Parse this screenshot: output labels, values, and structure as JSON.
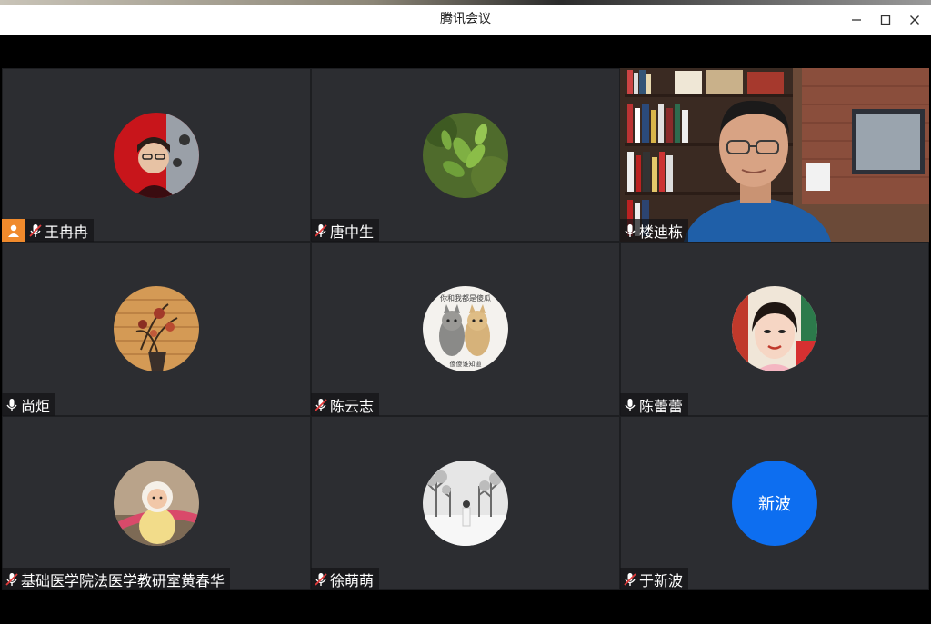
{
  "window": {
    "title": "腾讯会议"
  },
  "participants": [
    {
      "name": "王冉冉",
      "mic": "muted",
      "host": true,
      "avatar": "red-portrait-avatar"
    },
    {
      "name": "唐中生",
      "mic": "muted",
      "host": false,
      "avatar": "green-leaves-avatar"
    },
    {
      "name": "楼迪栋",
      "mic": "on",
      "host": false,
      "avatar": "camera-video",
      "active": true
    },
    {
      "name": "尚炬",
      "mic": "on",
      "host": false,
      "avatar": "flower-vase-avatar"
    },
    {
      "name": "陈云志",
      "mic": "muted",
      "host": false,
      "avatar": "two-cats-avatar",
      "avatar_text": [
        "你和我都是傻瓜",
        "傻傻谁知道"
      ]
    },
    {
      "name": "陈蕾蕾",
      "mic": "on",
      "host": false,
      "avatar": "woman-portrait-avatar"
    },
    {
      "name": "基础医学院法医学教研室黄春华",
      "mic": "muted",
      "host": false,
      "avatar": "child-photo-avatar"
    },
    {
      "name": "徐萌萌",
      "mic": "muted",
      "host": false,
      "avatar": "snow-scene-avatar"
    },
    {
      "name": "于新波",
      "mic": "muted",
      "host": false,
      "avatar": "text-avatar",
      "avatar_label": "新波"
    }
  ],
  "colors": {
    "tile_bg": "#2c2d31",
    "active_border": "#1f9d55",
    "host_badge": "#f08a2c",
    "text_avatar": "#0d6ef0"
  }
}
